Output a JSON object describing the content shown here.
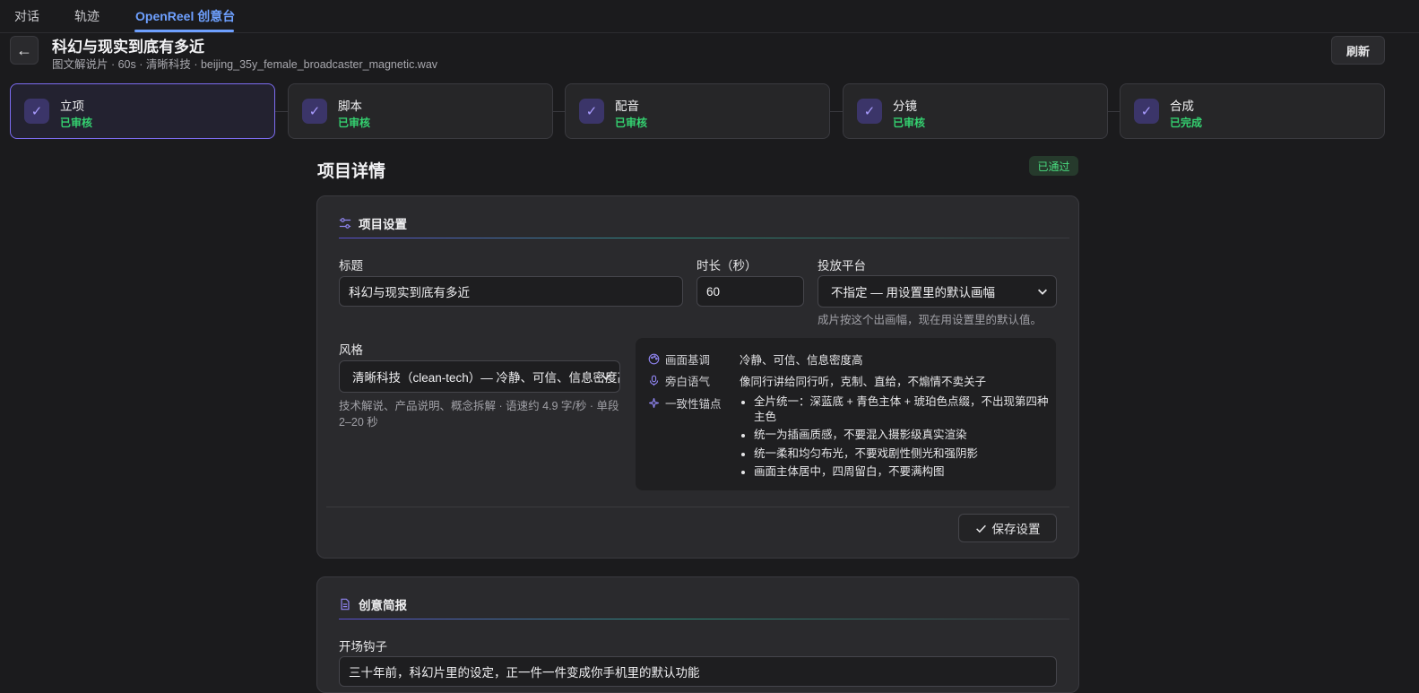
{
  "topnav": {
    "tabs": [
      {
        "label": "对话"
      },
      {
        "label": "轨迹"
      },
      {
        "label": "OpenReel 创意台"
      }
    ]
  },
  "header": {
    "back_icon": "←",
    "title": "科幻与现实到底有多近",
    "subtitle": "图文解说片 · 60s · 清晰科技 · beijing_35y_female_broadcaster_magnetic.wav",
    "refresh_label": "刷新"
  },
  "steps": [
    {
      "name": "立项",
      "status": "已审核"
    },
    {
      "name": "脚本",
      "status": "已审核"
    },
    {
      "name": "配音",
      "status": "已审核"
    },
    {
      "name": "分镜",
      "status": "已审核"
    },
    {
      "name": "合成",
      "status": "已完成"
    }
  ],
  "section": {
    "title": "项目详情",
    "badge": "已通过"
  },
  "settings": {
    "heading": "项目设置",
    "title_label": "标题",
    "title_value": "科幻与现实到底有多近",
    "duration_label": "时长（秒）",
    "duration_value": "60",
    "platform_label": "投放平台",
    "platform_value": "不指定 — 用设置里的默认画幅",
    "platform_hint": "成片按这个出画幅，现在用设置里的默认值。",
    "style_label": "风格",
    "style_value": "清晰科技（clean-tech）— 冷静、可信、信息密度高",
    "style_hint": "技术解说、产品说明、概念拆解 · 语速约 4.9 字/秒 · 单段 2–20 秒",
    "style_panel": {
      "tone_label": "画面基调",
      "tone_value": "冷静、可信、信息密度高",
      "voice_label": "旁白语气",
      "voice_value": "像同行讲给同行听，克制、直给，不煽情不卖关子",
      "anchor_label": "一致性锚点",
      "anchors": [
        "全片统一：深蓝底 + 青色主体 + 琥珀色点缀，不出现第四种主色",
        "统一为插画质感，不要混入摄影级真实渲染",
        "统一柔和均匀布光，不要戏剧性侧光和强阴影",
        "画面主体居中，四周留白，不要满构图"
      ]
    },
    "save_label": "保存设置"
  },
  "brief": {
    "heading": "创意简报",
    "hook_label": "开场钩子",
    "hook_value": "三十年前，科幻片里的设定，正一件一件变成你手机里的默认功能"
  },
  "colors": {
    "accent": "#6ea0ff",
    "step_active": "#7c6cf0",
    "success": "#34d170"
  }
}
